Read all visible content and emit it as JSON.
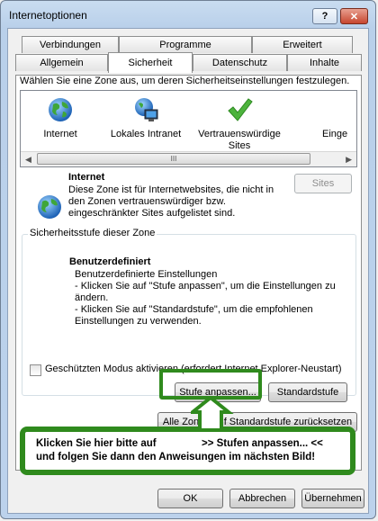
{
  "window": {
    "title": "Internetoptionen",
    "help_label": "?",
    "close_label": "✕"
  },
  "tabs_row1": [
    {
      "label": "Verbindungen"
    },
    {
      "label": "Programme"
    },
    {
      "label": "Erweitert"
    }
  ],
  "tabs_row2": [
    {
      "label": "Allgemein"
    },
    {
      "label": "Sicherheit",
      "active": true
    },
    {
      "label": "Datenschutz"
    },
    {
      "label": "Inhalte"
    }
  ],
  "security": {
    "instruction": "Wählen Sie eine Zone aus, um deren Sicherheitseinstellungen festzulegen.",
    "zones": [
      {
        "label": "Internet",
        "icon": "globe-icon"
      },
      {
        "label": "Lokales Intranet",
        "icon": "intranet-icon"
      },
      {
        "label": "Vertrauenswürdige",
        "label2": "Sites",
        "icon": "checkmark-icon"
      },
      {
        "label": "Einge",
        "icon": "restricted-icon"
      }
    ],
    "scroll_grip": "III",
    "selected_zone": {
      "name": "Internet",
      "line1": "Diese Zone ist für Internetwebsites, die nicht in",
      "line2": "den Zonen vertrauenswürdiger bzw.",
      "line3": "eingeschränkter Sites aufgelistet sind.",
      "sites_button": "Sites"
    },
    "level_group": {
      "legend": "Sicherheitsstufe dieser Zone",
      "title": "Benutzerdefiniert",
      "line1": "Benutzerdefinierte Einstellungen",
      "line2": "- Klicken Sie auf \"Stufe anpassen\", um die Einstellungen zu",
      "line3": "ändern.",
      "line4": "- Klicken Sie auf \"Standardstufe\", um die empfohlenen",
      "line5": "Einstellungen zu verwenden."
    },
    "protected_mode_label": "Geschützten Modus aktivieren (erfordert Internet Explorer-Neustart)",
    "protected_mode_checked": false,
    "custom_level_button": "Stufe anpassen...",
    "default_level_button": "Standardstufe",
    "reset_all_button": "Alle Zonen auf Standardstufe zurücksetzen"
  },
  "callout": {
    "line1_a": "Klicken Sie hier bitte auf",
    "line1_b": ">>  Stufen anpassen...  <<",
    "line2": "und folgen Sie dann den Anweisungen im nächsten Bild!"
  },
  "footer": {
    "ok": "OK",
    "cancel": "Abbrechen",
    "apply": "Übernehmen"
  },
  "colors": {
    "highlight": "#2f8a1d",
    "window_frame": "#bcd2ec"
  }
}
